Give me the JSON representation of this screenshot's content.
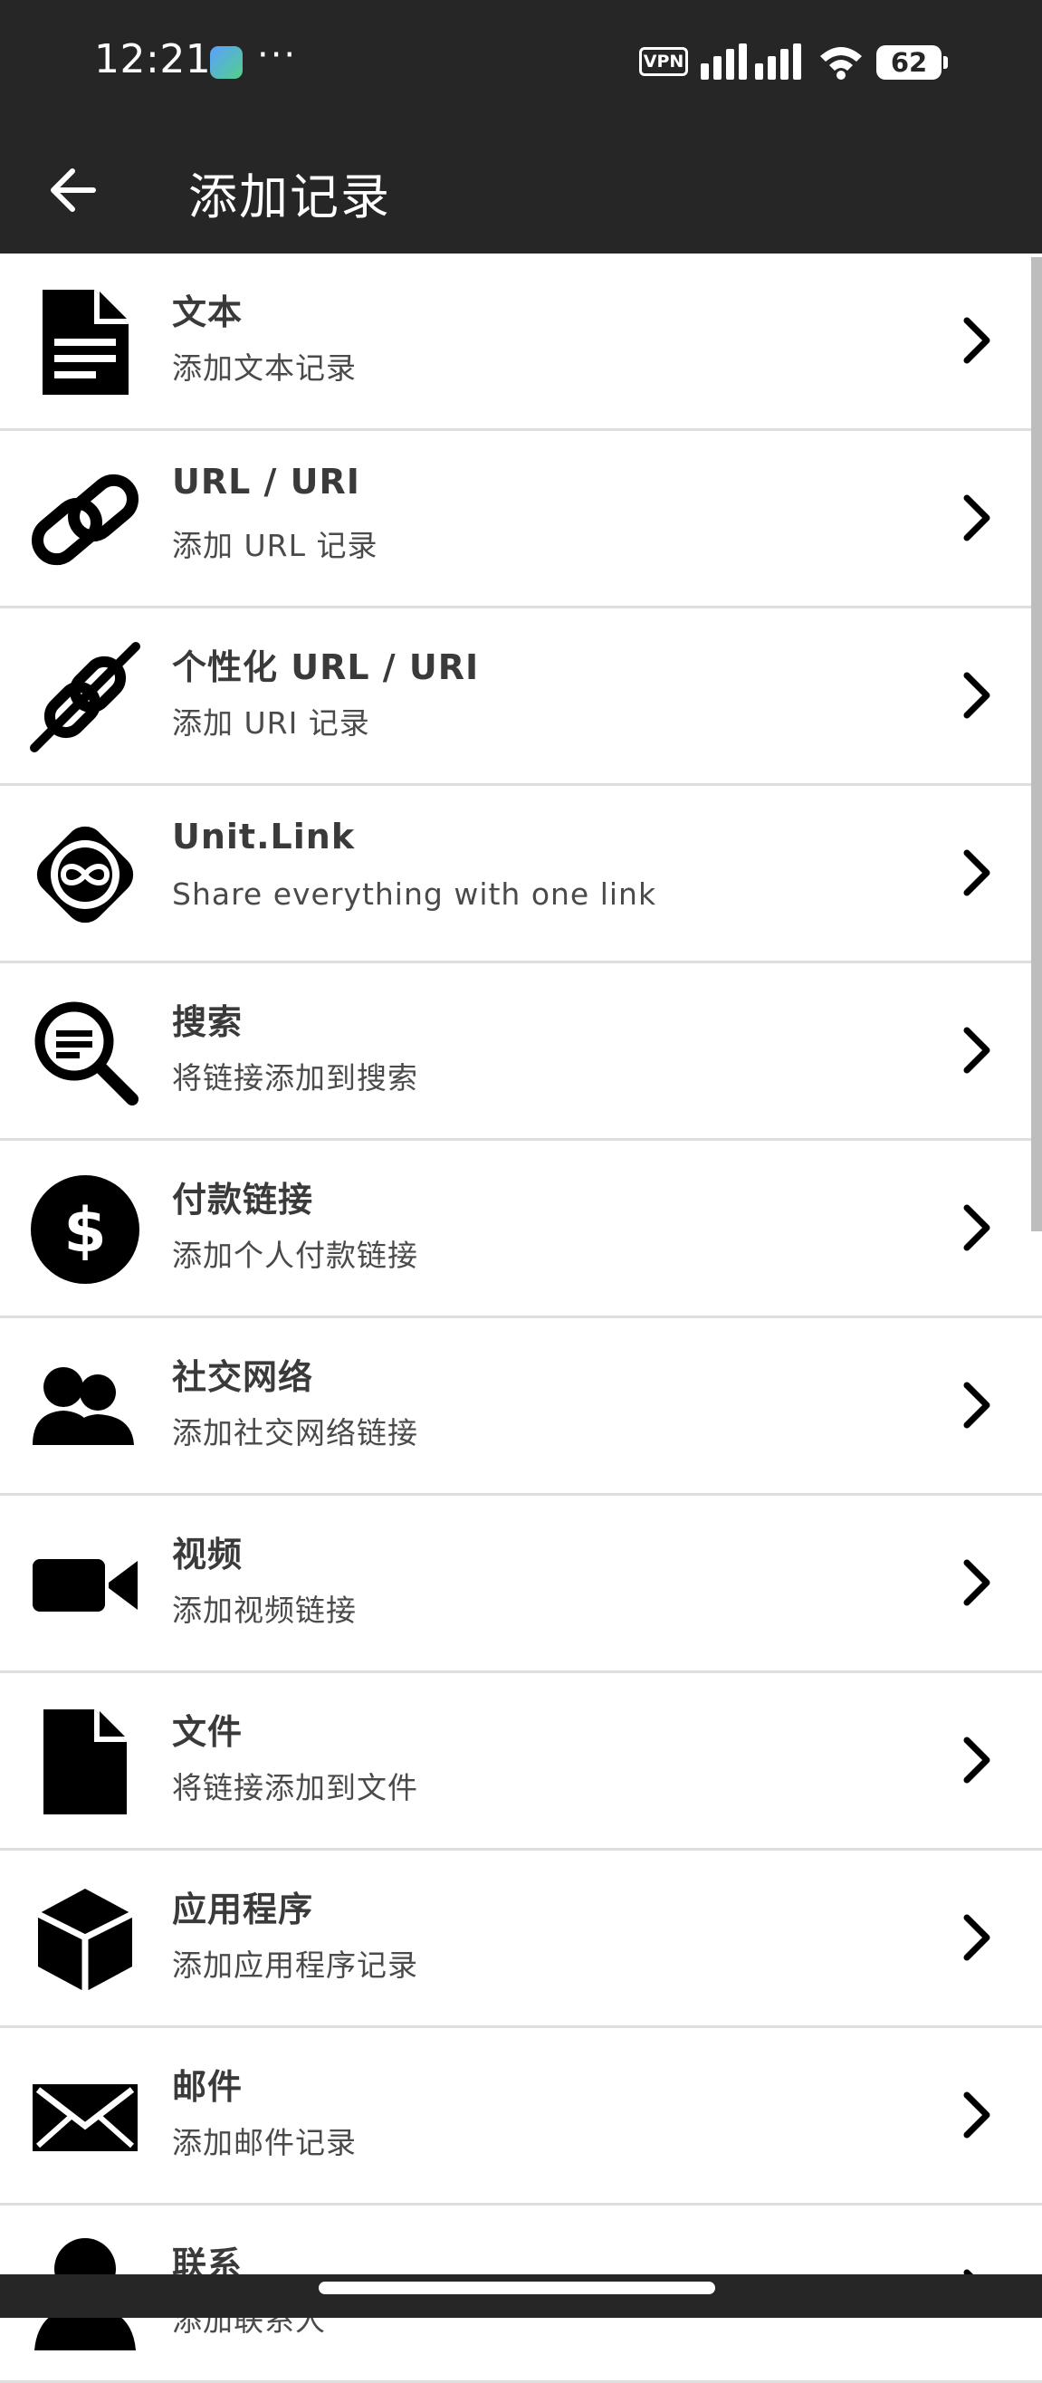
{
  "status_bar": {
    "time": "12:21",
    "more": "···",
    "vpn": "VPN",
    "battery": "62"
  },
  "header": {
    "title": "添加记录",
    "back_icon": "arrow-back-icon"
  },
  "items": [
    {
      "title": "文本",
      "subtitle": "添加文本记录",
      "icon": "document-icon"
    },
    {
      "title": "URL / URI",
      "subtitle": "添加 URL 记录",
      "icon": "link-icon"
    },
    {
      "title": "个性化 URL / URI",
      "subtitle": "添加 URI 记录",
      "icon": "custom-link-icon"
    },
    {
      "title": "Unit.Link",
      "subtitle": "Share everything with one link",
      "icon": "infinity-badge-icon"
    },
    {
      "title": "搜索",
      "subtitle": "将链接添加到搜索",
      "icon": "search-icon"
    },
    {
      "title": "付款链接",
      "subtitle": "添加个人付款链接",
      "icon": "dollar-icon"
    },
    {
      "title": "社交网络",
      "subtitle": "添加社交网络链接",
      "icon": "people-icon"
    },
    {
      "title": "视频",
      "subtitle": "添加视频链接",
      "icon": "video-camera-icon"
    },
    {
      "title": "文件",
      "subtitle": "将链接添加到文件",
      "icon": "file-icon"
    },
    {
      "title": "应用程序",
      "subtitle": "添加应用程序记录",
      "icon": "cube-icon"
    },
    {
      "title": "邮件",
      "subtitle": "添加邮件记录",
      "icon": "envelope-icon"
    },
    {
      "title": "联系",
      "subtitle": "添加联系人",
      "icon": "person-icon"
    }
  ]
}
